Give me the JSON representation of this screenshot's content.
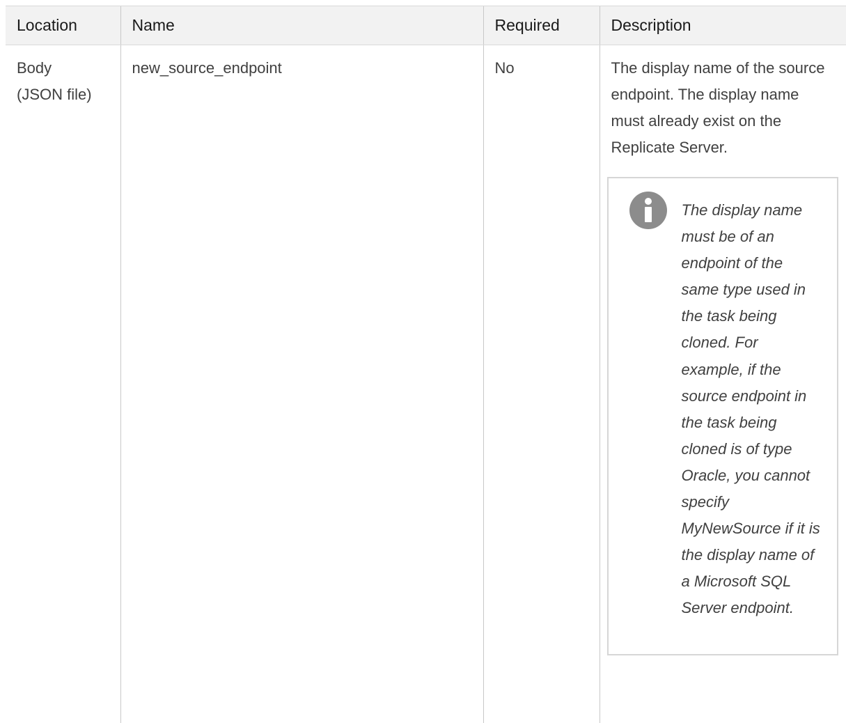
{
  "table": {
    "headers": {
      "location": "Location",
      "name": "Name",
      "required": "Required",
      "description": "Description"
    },
    "row": {
      "location": [
        "Body",
        "(JSON file)"
      ],
      "name": "new_source_endpoint",
      "required": "No",
      "description": "The display name of the source endpoint. The display name must already exist on the Replicate Server.",
      "note": {
        "icon": "info-icon",
        "icon_color": "#8c8c8c",
        "text": "The display name must be of an endpoint of the same type used in the task being cloned. For example, if the source endpoint in the task being cloned is of type Oracle, you cannot specify MyNewSource if it is the display name of a Microsoft SQL Server endpoint."
      }
    }
  }
}
